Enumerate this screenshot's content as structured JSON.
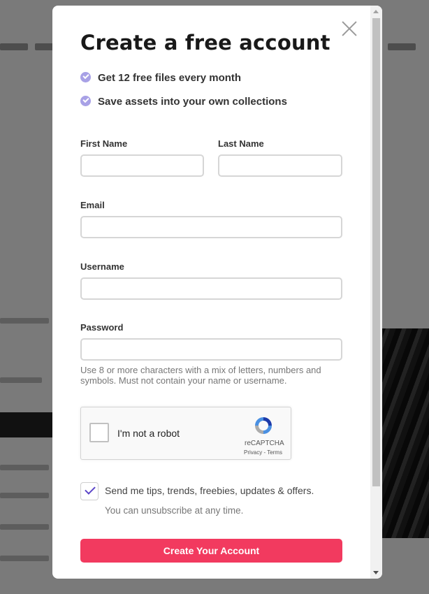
{
  "modal": {
    "title": "Create a free account",
    "benefits": [
      "Get 12 free files every month",
      "Save assets into your own collections"
    ],
    "fields": {
      "first_name": {
        "label": "First Name",
        "value": ""
      },
      "last_name": {
        "label": "Last Name",
        "value": ""
      },
      "email": {
        "label": "Email",
        "value": ""
      },
      "username": {
        "label": "Username",
        "value": ""
      },
      "password": {
        "label": "Password",
        "value": "",
        "hint": "Use 8 or more characters with a mix of letters, numbers and symbols. Must not contain your name or username."
      }
    },
    "captcha": {
      "label": "I'm not a robot",
      "brand": "reCAPTCHA",
      "links": "Privacy - Terms",
      "checked": false
    },
    "optin": {
      "checked": true,
      "label": "Send me tips, trends, freebies, updates & offers.",
      "sub": "You can unsubscribe at any time."
    },
    "submit_label": "Create Your Account"
  },
  "colors": {
    "accent": "#f23a5f",
    "check": "#a8a1e6",
    "optin_check": "#5b45c8"
  },
  "icons": {
    "close": "close-icon",
    "benefit": "check-circle-icon",
    "captcha": "recaptcha-icon"
  }
}
